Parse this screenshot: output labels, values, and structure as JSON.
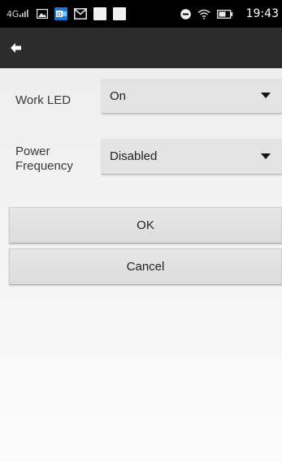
{
  "status_bar": {
    "network": "4G",
    "icons": [
      "signal-icon",
      "image-icon",
      "outlook-icon",
      "gmail-icon",
      "notification-placeholder-icon",
      "notification-placeholder-icon",
      "do-not-disturb-icon",
      "wifi-icon",
      "battery-icon"
    ],
    "time": "19:43"
  },
  "action_bar": {
    "back_icon": "back-arrow-icon"
  },
  "settings": {
    "work_led": {
      "label": "Work LED",
      "value": "On"
    },
    "power_frequency": {
      "label": "Power Frequency",
      "value": "Disabled"
    }
  },
  "buttons": {
    "ok_label": "OK",
    "cancel_label": "Cancel"
  },
  "colors": {
    "status_bar": "#000000",
    "action_bar": "#2c2c2c",
    "background": "#efefef",
    "control": "#e3e3e3"
  }
}
